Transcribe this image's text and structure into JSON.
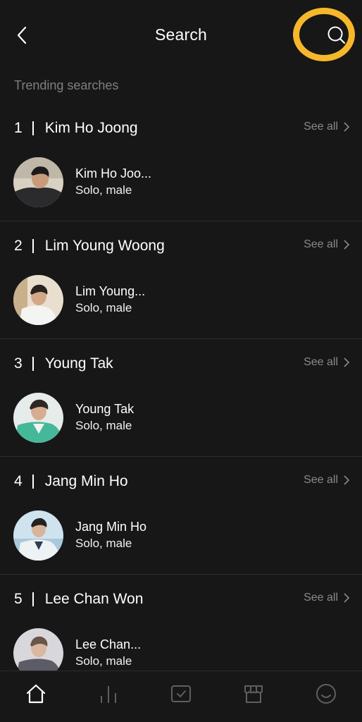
{
  "header": {
    "title": "Search",
    "back_icon": "chevron-left-icon",
    "search_icon": "search-icon",
    "highlight_color": "#f6b72b"
  },
  "trending_label": "Trending searches",
  "see_all_label": "See all",
  "results": [
    {
      "rank": "1",
      "name": "Kim Ho Joong",
      "artist_name": "Kim Ho Joo...",
      "artist_type": "Solo, male"
    },
    {
      "rank": "2",
      "name": "Lim Young Woong",
      "artist_name": "Lim Young...",
      "artist_type": "Solo, male"
    },
    {
      "rank": "3",
      "name": "Young Tak",
      "artist_name": "Young Tak",
      "artist_type": "Solo, male"
    },
    {
      "rank": "4",
      "name": "Jang Min Ho",
      "artist_name": "Jang Min Ho",
      "artist_type": "Solo, male"
    },
    {
      "rank": "5",
      "name": "Lee Chan Won",
      "artist_name": "Lee Chan...",
      "artist_type": "Solo, male"
    }
  ],
  "bottom_nav": [
    {
      "icon": "home-icon",
      "active": true
    },
    {
      "icon": "chart-icon",
      "active": false
    },
    {
      "icon": "vote-icon",
      "active": false
    },
    {
      "icon": "store-icon",
      "active": false
    },
    {
      "icon": "profile-icon",
      "active": false
    }
  ],
  "colors": {
    "background": "#171717",
    "text": "#ffffff",
    "muted": "#8a8a8a",
    "divider": "#2c2c2c"
  }
}
